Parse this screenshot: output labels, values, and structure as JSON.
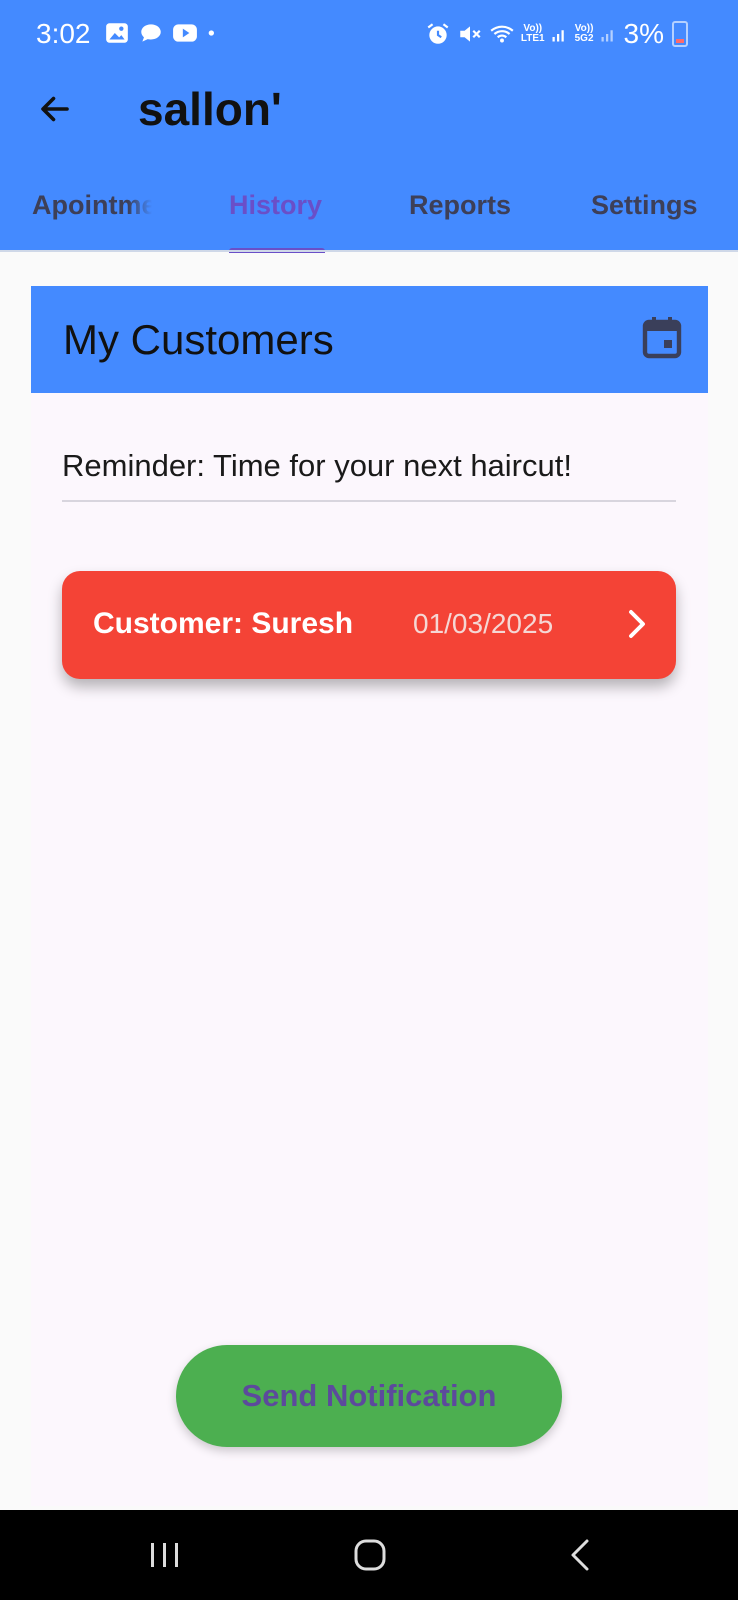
{
  "status_bar": {
    "time": "3:02",
    "lte_top": "Vo))",
    "lte_bottom": "LTE1",
    "g5_top": "Vo))",
    "g5_bottom": "5G2",
    "battery": "3%"
  },
  "app_bar": {
    "title": "sallon'"
  },
  "tabs": [
    {
      "label": "Apointments",
      "active": false
    },
    {
      "label": "History",
      "active": true
    },
    {
      "label": "Reports",
      "active": false
    },
    {
      "label": "Settings",
      "active": false
    }
  ],
  "section": {
    "title": "My Customers"
  },
  "reminder": {
    "value": "Reminder: Time for your next haircut!"
  },
  "customers": [
    {
      "name": "Customer: Suresh",
      "date": "01/03/2025"
    }
  ],
  "send_button": {
    "label": "Send Notification"
  },
  "colors": {
    "app_bar": "#448AFF",
    "active_tab": "#6a4fc8",
    "customer_card": "#F44336",
    "send_button": "#4CAF50",
    "nav_bar": "#000000"
  }
}
